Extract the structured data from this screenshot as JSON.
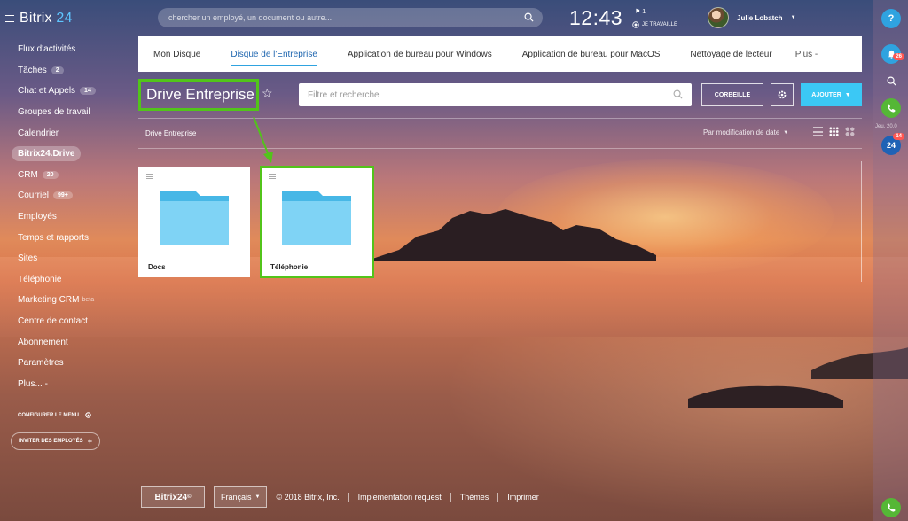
{
  "app": {
    "logo": "Bitrix",
    "logo_num": "24"
  },
  "sidebar": {
    "items": [
      {
        "label": "Flux d'activités"
      },
      {
        "label": "Tâches",
        "badge": "2"
      },
      {
        "label": "Chat et Appels",
        "badge": "14"
      },
      {
        "label": "Groupes de travail"
      },
      {
        "label": "Calendrier"
      },
      {
        "label": "Bitrix24.Drive",
        "active": true
      },
      {
        "label": "CRM",
        "badge": "20"
      },
      {
        "label": "Courriel",
        "badge": "99+"
      },
      {
        "label": "Employés"
      },
      {
        "label": "Temps et rapports"
      },
      {
        "label": "Sites"
      },
      {
        "label": "Téléphonie"
      },
      {
        "label": "Marketing CRM",
        "beta": "beta"
      },
      {
        "label": "Centre de contact"
      },
      {
        "label": "Abonnement"
      },
      {
        "label": "Paramètres"
      },
      {
        "label": "Plus... -"
      }
    ],
    "configure_label": "CONFIGURER LE MENU",
    "invite_label": "INVITER DES EMPLOYÉS"
  },
  "header": {
    "search_placeholder": "chercher un employé, un document ou autre...",
    "time": "12:43",
    "flag_count": "1",
    "work_status": "JE TRAVAILLE",
    "user_name": "Julie Lobatch"
  },
  "right_panel": {
    "help": "?",
    "notif_badge": "26",
    "time_label": "Jeu. 20.0",
    "chat_badge": "14",
    "chat_label": "24"
  },
  "tabs": [
    {
      "label": "Mon Disque"
    },
    {
      "label": "Disque de l'Entreprise",
      "active": true
    },
    {
      "label": "Application de bureau pour Windows"
    },
    {
      "label": "Application de bureau pour MacOS"
    },
    {
      "label": "Nettoyage de lecteur"
    },
    {
      "label": "Plus -"
    }
  ],
  "page": {
    "title": "Drive Entreprise",
    "filter_placeholder": "Filtre et recherche",
    "trash_label": "CORBEILLE",
    "add_label": "AJOUTER",
    "breadcrumb": "Drive Entreprise",
    "sort_label": "Par modification de date"
  },
  "folders": [
    {
      "name": "Docs"
    },
    {
      "name": "Téléphonie"
    }
  ],
  "footer": {
    "logo": "Bitrix24",
    "language": "Français",
    "copyright": "© 2018 Bitrix, Inc.",
    "links": [
      "Implementation request",
      "Thèmes",
      "Imprimer"
    ]
  },
  "colors": {
    "accent_blue": "#3bc8f5",
    "highlight_green": "#52c41a",
    "active_tab": "#2067b0",
    "folder_blue": "#5ec4ef"
  }
}
